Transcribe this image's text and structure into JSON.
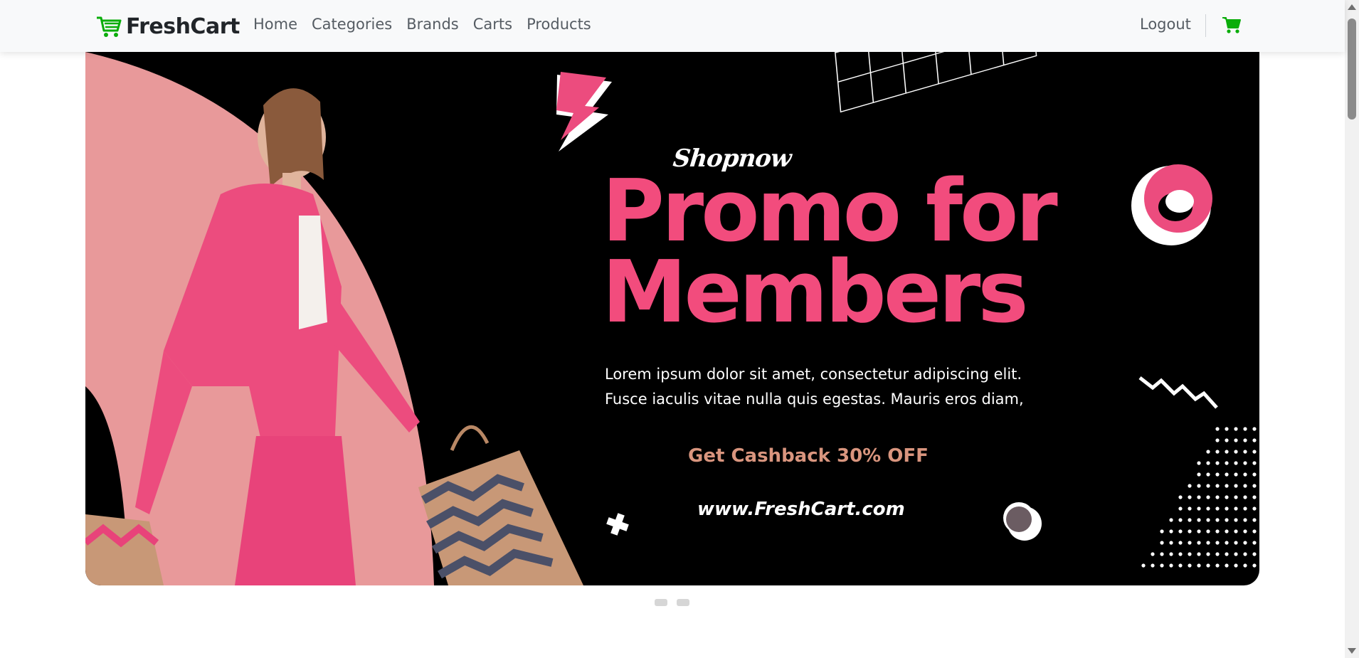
{
  "navbar": {
    "brand": "FreshCart",
    "brand_icon": "shopping-cart-icon",
    "links": [
      "Home",
      "Categories",
      "Brands",
      "Carts",
      "Products"
    ],
    "logout": "Logout",
    "cart_icon": "shopping-cart-icon"
  },
  "banner": {
    "tagline": "Shopnow",
    "headline_line1": "Promo for",
    "headline_line2": "Members",
    "body_line1": "Lorem ipsum dolor sit amet, consectetur adipiscing elit.",
    "body_line2": "Fusce iaculis vitae nulla quis egestas. Mauris eros diam,",
    "cashback": "Get Cashback 30% OFF",
    "website": "www.FreshCart.com"
  },
  "carousel": {
    "slide_count": 2,
    "active_index": 0
  },
  "colors": {
    "brand_green": "#0aad0a",
    "promo_pink": "#f24c7d",
    "banner_bg": "#000000",
    "cashback_peach": "#d9957e",
    "arc_pink": "#e8999a"
  }
}
